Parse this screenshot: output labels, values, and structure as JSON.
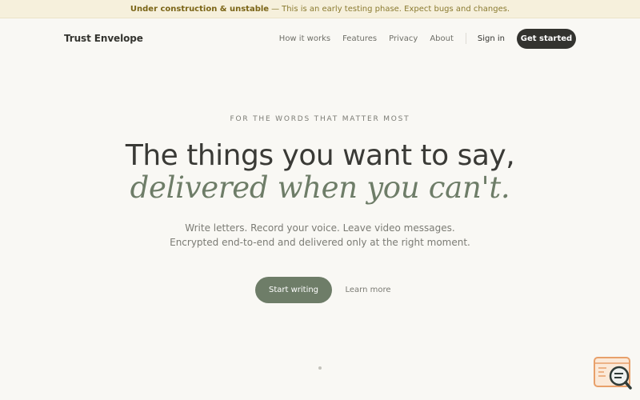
{
  "banner": {
    "strong": "Under construction & unstable",
    "separator": "—",
    "message": "This is an early testing phase. Expect bugs and changes."
  },
  "nav": {
    "brand": "Trust Envelope",
    "links": [
      "How it works",
      "Features",
      "Privacy",
      "About"
    ],
    "sign_in": "Sign in",
    "get_started": "Get started"
  },
  "hero": {
    "eyebrow": "FOR THE WORDS THAT MATTER MOST",
    "headline": "The things you want to say,",
    "headline_em": "delivered when you can't.",
    "sub_line1": "Write letters. Record your voice. Leave video messages.",
    "sub_line2": "Encrypted end-to-end and delivered only at the right moment.",
    "start_writing": "Start writing",
    "learn_more": "Learn more"
  },
  "colors": {
    "background": "#f9f8f4",
    "accent_green": "#6e7d68",
    "dark": "#33332f",
    "banner_bg": "#f6f0dc",
    "banner_text": "#8a7a30",
    "widget_orange": "#e8a06a"
  },
  "icons": {
    "widget": "feedback-magnifier-icon"
  }
}
